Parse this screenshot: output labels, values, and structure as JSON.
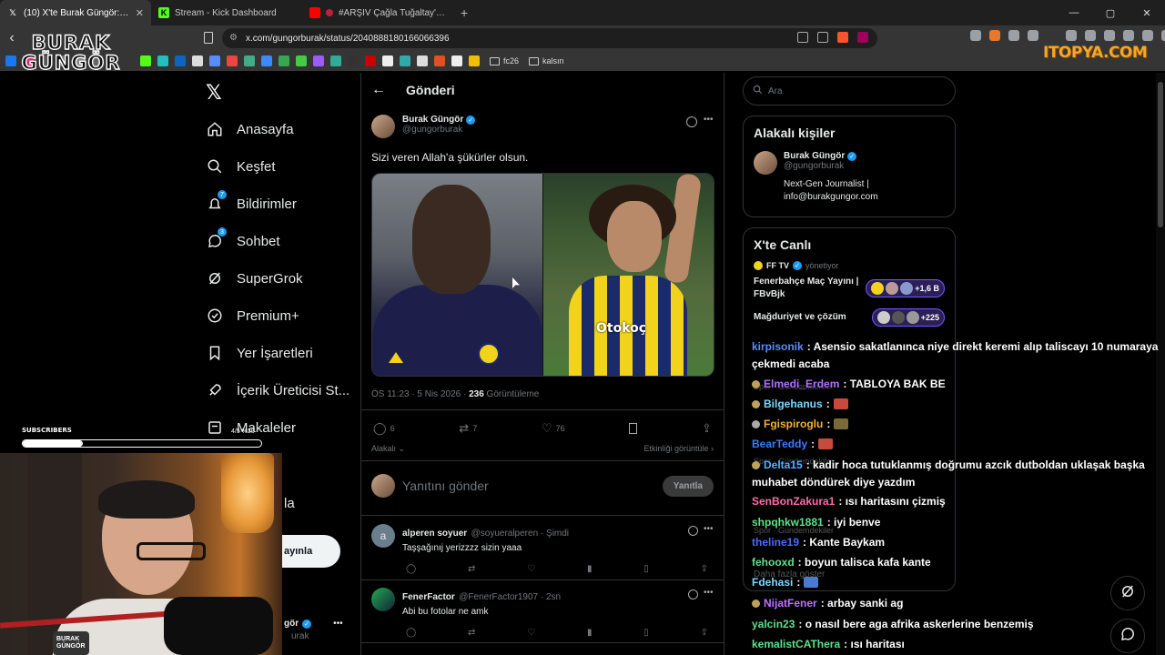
{
  "browser": {
    "tabs": [
      {
        "title": "(10) X'te Burak Güngör: \"Sizi veren",
        "favicon": "x-icon",
        "active": true
      },
      {
        "title": "Stream - Kick Dashboard",
        "favicon": "kick-icon",
        "active": false
      },
      {
        "title": "#ARŞİV Çağla Tuğaltay'ın Katili K",
        "favicon": "youtube-icon",
        "active": false
      }
    ],
    "url": "x.com/gungorburak/status/2040888180166066396",
    "bookmark_folders": [
      "fc26",
      "kalsın"
    ]
  },
  "overlay": {
    "logo_line1": "BURAK",
    "logo_line2": "GÜNGÖR",
    "sponsor": "ITOPYA.COM",
    "subscribers_label": "SUBSCRIBERS",
    "subscribers_count": "4/5 %20",
    "subscribers_progress": 0.25,
    "cup_text_1": "BURAK",
    "cup_text_2": "GÜNGÖR"
  },
  "nav": {
    "items": [
      {
        "label": "Anasayfa",
        "icon": "home-icon"
      },
      {
        "label": "Keşfet",
        "icon": "search-icon"
      },
      {
        "label": "Bildirimler",
        "icon": "bell-icon",
        "badge": "7"
      },
      {
        "label": "Sohbet",
        "icon": "chat-icon",
        "badge": "3"
      },
      {
        "label": "SuperGrok",
        "icon": "grok-icon"
      },
      {
        "label": "Premium+",
        "icon": "premium-icon"
      },
      {
        "label": "Yer İşaretleri",
        "icon": "bookmark-icon"
      },
      {
        "label": "İçerik Üreticisi St...",
        "icon": "rocket-icon"
      },
      {
        "label": "Makaleler",
        "icon": "article-icon"
      }
    ],
    "partial_label": "la",
    "post_button": "ayınla",
    "profile_name": "gör",
    "profile_handle": "urak"
  },
  "post": {
    "header": "Gönderi",
    "author_name": "Burak Güngör",
    "author_handle": "@gungorburak",
    "text": "Sizi veren Allah'a şükürler olsun.",
    "image_text": "Otokoç",
    "time": "ÖS 11:23 · 5 Nis 2026 · ",
    "views": "236",
    "views_label": " Görüntüleme",
    "replies": "6",
    "reposts": "7",
    "likes": "76",
    "relevance": "Alakalı",
    "activity": "Etkinliği görüntüle",
    "reply_placeholder": "Yanıtını gönder",
    "reply_button": "Yanıtla"
  },
  "replies": [
    {
      "name": "alperen soyuer",
      "handle": "@soyueralperen · Şimdi",
      "text": "Taşşağınıj yerizzzz sizin yaaa",
      "avatar": "a"
    },
    {
      "name": "FenerFactor",
      "handle": "@FenerFactor1907 · 2sn",
      "text": "Abi bu fotolar ne amk",
      "avatar": ""
    }
  ],
  "sidebar": {
    "search_placeholder": "Ara",
    "related_title": "Alakalı kişiler",
    "related_name": "Burak Güngör",
    "related_handle": "@gungorburak",
    "related_bio_1": "Next-Gen Journalist |",
    "related_bio_2": "info@burakgungor.com",
    "live_title": "X'te Canlı",
    "live_host": "FF TV",
    "live_host_suffix": "yönetiyor",
    "live1_title": "Fenerbahçe Maç Yayını | FBvBjk",
    "live1_count": "+1,6 B",
    "live2_title": "Mağduriyet ve çözüm önerileri #adalet",
    "live2_count": "+225"
  },
  "chat": [
    {
      "user": "kirpisonik",
      "color": "#5b8cff",
      "msg": ": Asensio sakatlanınca niye direkt keremi alıp taliscayı 10 numaraya"
    },
    {
      "user": "",
      "color": "#fff",
      "msg": "çekmedi acaba"
    },
    {
      "user": "Elmedi_Erdem",
      "color": "#b070ff",
      "msg": ": TABLOYA BAK BE"
    },
    {
      "user": "Bilgehanus",
      "color": "#7fd6ff",
      "msg": ":"
    },
    {
      "user": "Fgispiroglu",
      "color": "#f2b03a",
      "msg": ":"
    },
    {
      "user": "BearTeddy",
      "color": "#3a7bff",
      "msg": ":"
    },
    {
      "user": "Delta15",
      "color": "#5ab0ff",
      "msg": ": kadir hoca tutuklanmış doğrumu azcık dutboldan uklaşak başka"
    },
    {
      "user": "",
      "color": "#fff",
      "msg": "muhabet döndürek diye yazdım"
    },
    {
      "user": "SenBonZakura1",
      "color": "#ff6aa8",
      "msg": ": ısı haritasını çizmiş"
    },
    {
      "user": "shpqhkw1881",
      "color": "#5fe08a",
      "msg": ": iyi benve"
    },
    {
      "user": "theline19",
      "color": "#4a6cff",
      "msg": ": Kante Baykam"
    },
    {
      "user": "fehooxd",
      "color": "#5fe08a",
      "msg": ": boyun talisca kafa kante"
    },
    {
      "user": "Fdehasi",
      "color": "#7fd6ff",
      "msg": ":"
    },
    {
      "user": "NijatFener",
      "color": "#c070ff",
      "msg": ": arbay sanki ag"
    },
    {
      "user": "yalcin23",
      "color": "#5fe08a",
      "msg": ": o nasıl bere aga afrika askerlerine benzemiş"
    },
    {
      "user": "kemalistCAThera",
      "color": "#5fe08a",
      "msg": ": ısı haritası"
    }
  ],
  "chat_faint": {
    "section": "Spor · Gündemdekiler",
    "more": "Daha fazla göster"
  },
  "colors": {
    "x_blue": "#1d9bf0",
    "background": "#000000",
    "border": "#2f3336",
    "muted": "#71767b"
  }
}
